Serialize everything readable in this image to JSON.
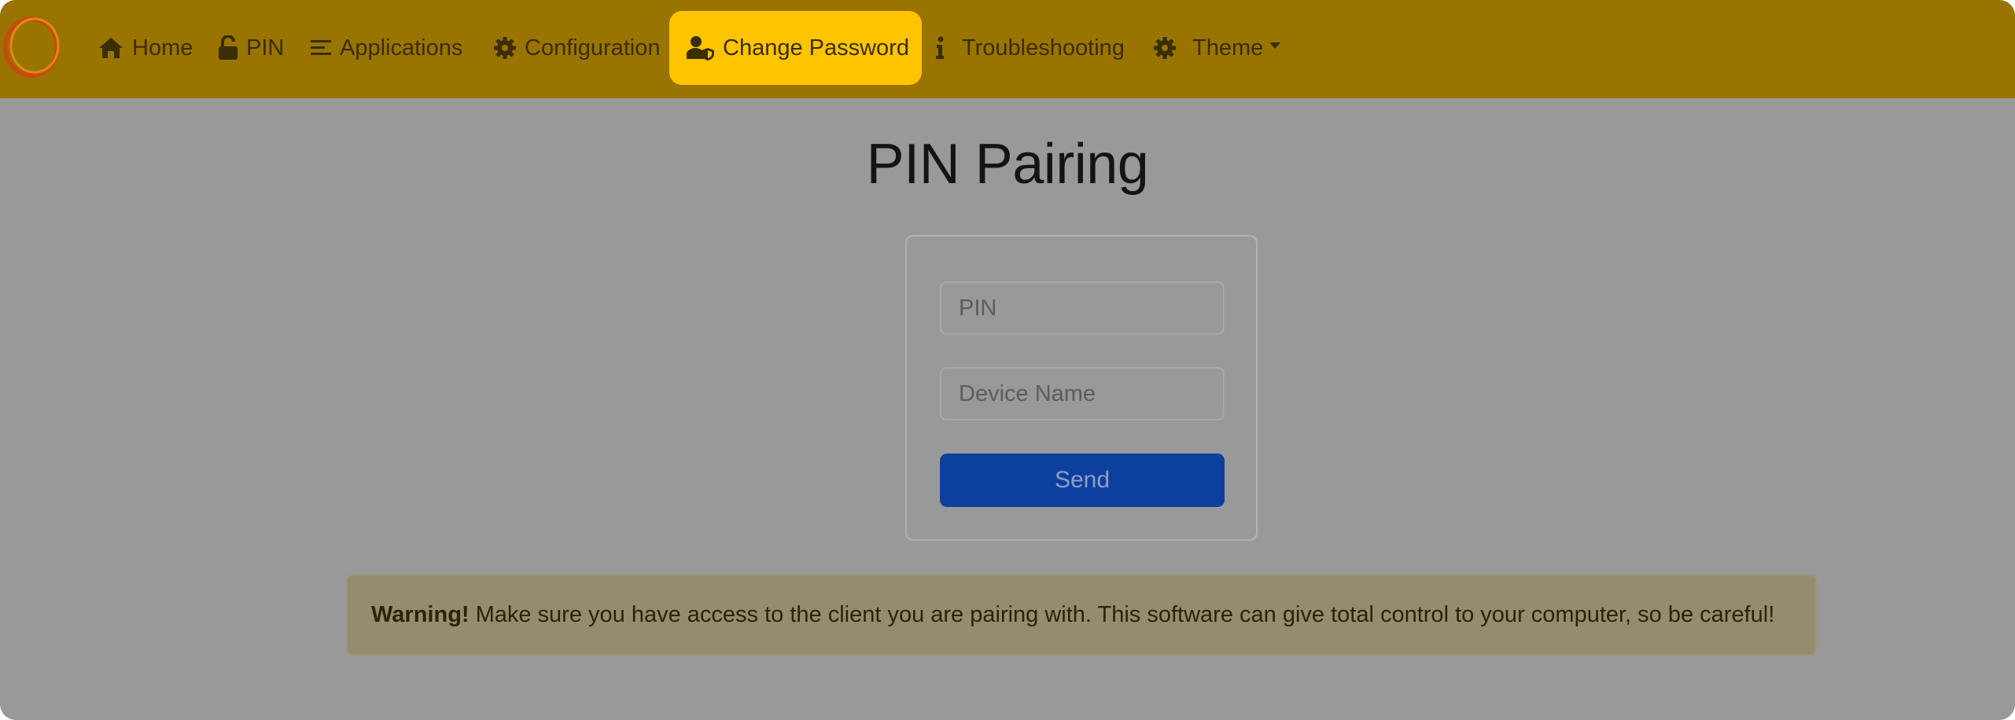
{
  "nav": {
    "items": [
      {
        "label": "Home",
        "icon": "home-icon"
      },
      {
        "label": "PIN",
        "icon": "unlock-icon"
      },
      {
        "label": "Applications",
        "icon": "list-icon"
      },
      {
        "label": "Configuration",
        "icon": "gear-icon"
      },
      {
        "label": "Change Password",
        "icon": "user-shield-icon",
        "active": true
      },
      {
        "label": "Troubleshooting",
        "icon": "info-icon"
      },
      {
        "label": "Theme",
        "icon": "gear-icon",
        "dropdown": true
      }
    ]
  },
  "page": {
    "title": "PIN Pairing"
  },
  "form": {
    "pin_placeholder": "PIN",
    "device_placeholder": "Device Name",
    "send_label": "Send"
  },
  "alert": {
    "strong": "Warning!",
    "text": "Make sure you have access to the client you are pairing with. This software can give total control to your computer, so be careful!"
  },
  "colors": {
    "navbar": "#997400",
    "active_tab": "#ffc400",
    "send_button": "#0d3f9e",
    "overlay": "#999999"
  }
}
